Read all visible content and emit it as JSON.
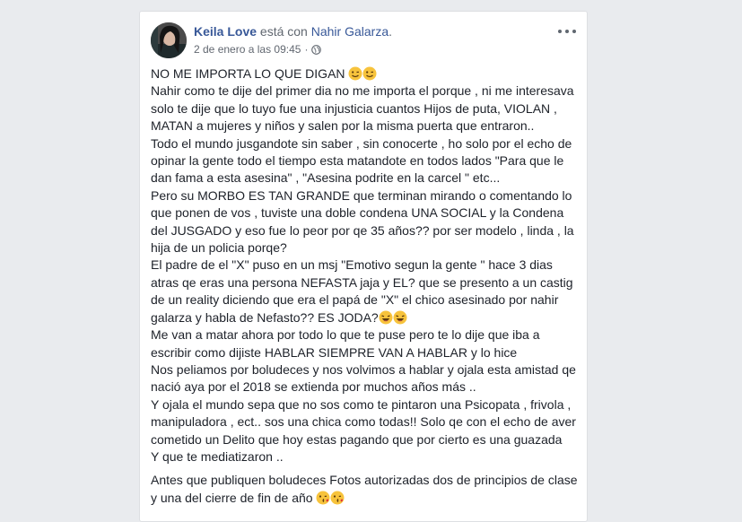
{
  "post": {
    "author": "Keila Love",
    "with_text": "está con",
    "tagged": "Nahir Galarza",
    "tagged_suffix": ".",
    "timestamp": "2 de enero a las 09:45",
    "separator": "·",
    "privacy_icon": "globe-icon",
    "more_icon": "more-options-icon",
    "lines": [
      "NO ME IMPORTA LO QUE DIGAN",
      "Nahir como te dije del primer dia no me importa el porque , ni me interesava",
      "solo te dije que lo tuyo fue una injusticia cuantos Hijos de puta, VIOLAN ,",
      "MATAN a mujeres y niños y salen por la misma puerta que entraron..",
      "Todo el mundo jusgandote sin saber , sin conocerte , ho solo por el echo de",
      "opinar la gente todo el tiempo esta matandote en todos lados \"Para que le",
      "dan fama a esta asesina\" , \"Asesina podrite en la carcel \" etc...",
      "Pero su MORBO ES TAN GRANDE que terminan mirando o comentando lo",
      "que ponen de vos , tuviste una doble condena UNA SOCIAL y la Condena",
      "del JUSGADO y eso fue lo peor por qe 35 años?? por ser modelo , linda , la",
      "hija de un policia porqe?",
      "El padre de el \"X\" puso en un msj \"Emotivo segun la gente \" hace 3 dias",
      "atras qe eras una persona NEFASTA jaja y EL? que se presento a un castig",
      "de un reality diciendo que era el papá de \"X\" el chico asesinado por nahir",
      "galarza y habla de Nefasto?? ES JODA?",
      "Me van a matar ahora por todo lo que te puse pero te lo dije que iba a",
      "escribir como dijiste HABLAR SIEMPRE VAN A HABLAR y lo hice",
      "Nos peliamos por boludeces y nos volvimos a hablar y ojala esta amistad qe",
      "nació aya por el 2018 se extienda por muchos años más ..",
      "Y ojala el mundo sepa que no sos como te pintaron una Psicopata , frivola ,",
      "manipuladora , ect.. sos una chica como todas!! Solo qe con el echo de aver",
      "cometido un Delito que hoy estas pagando que por cierto es una guazada",
      "Y que te mediatizaron ..",
      "Antes que publiquen boludeces Fotos autorizadas dos de principios de clase",
      "y una del cierre de fin de año"
    ],
    "emojis": {
      "line_1": [
        "wink-emoji",
        "wink-emoji"
      ],
      "line_15": [
        "laughing-emoji",
        "laughing-emoji"
      ],
      "line_25": [
        "kiss-emoji",
        "kiss-emoji"
      ]
    },
    "colors": {
      "link": "#385898",
      "text": "#1d2129",
      "meta": "#616770",
      "background": "#e9ebee",
      "emoji": "#f7c33c"
    }
  }
}
